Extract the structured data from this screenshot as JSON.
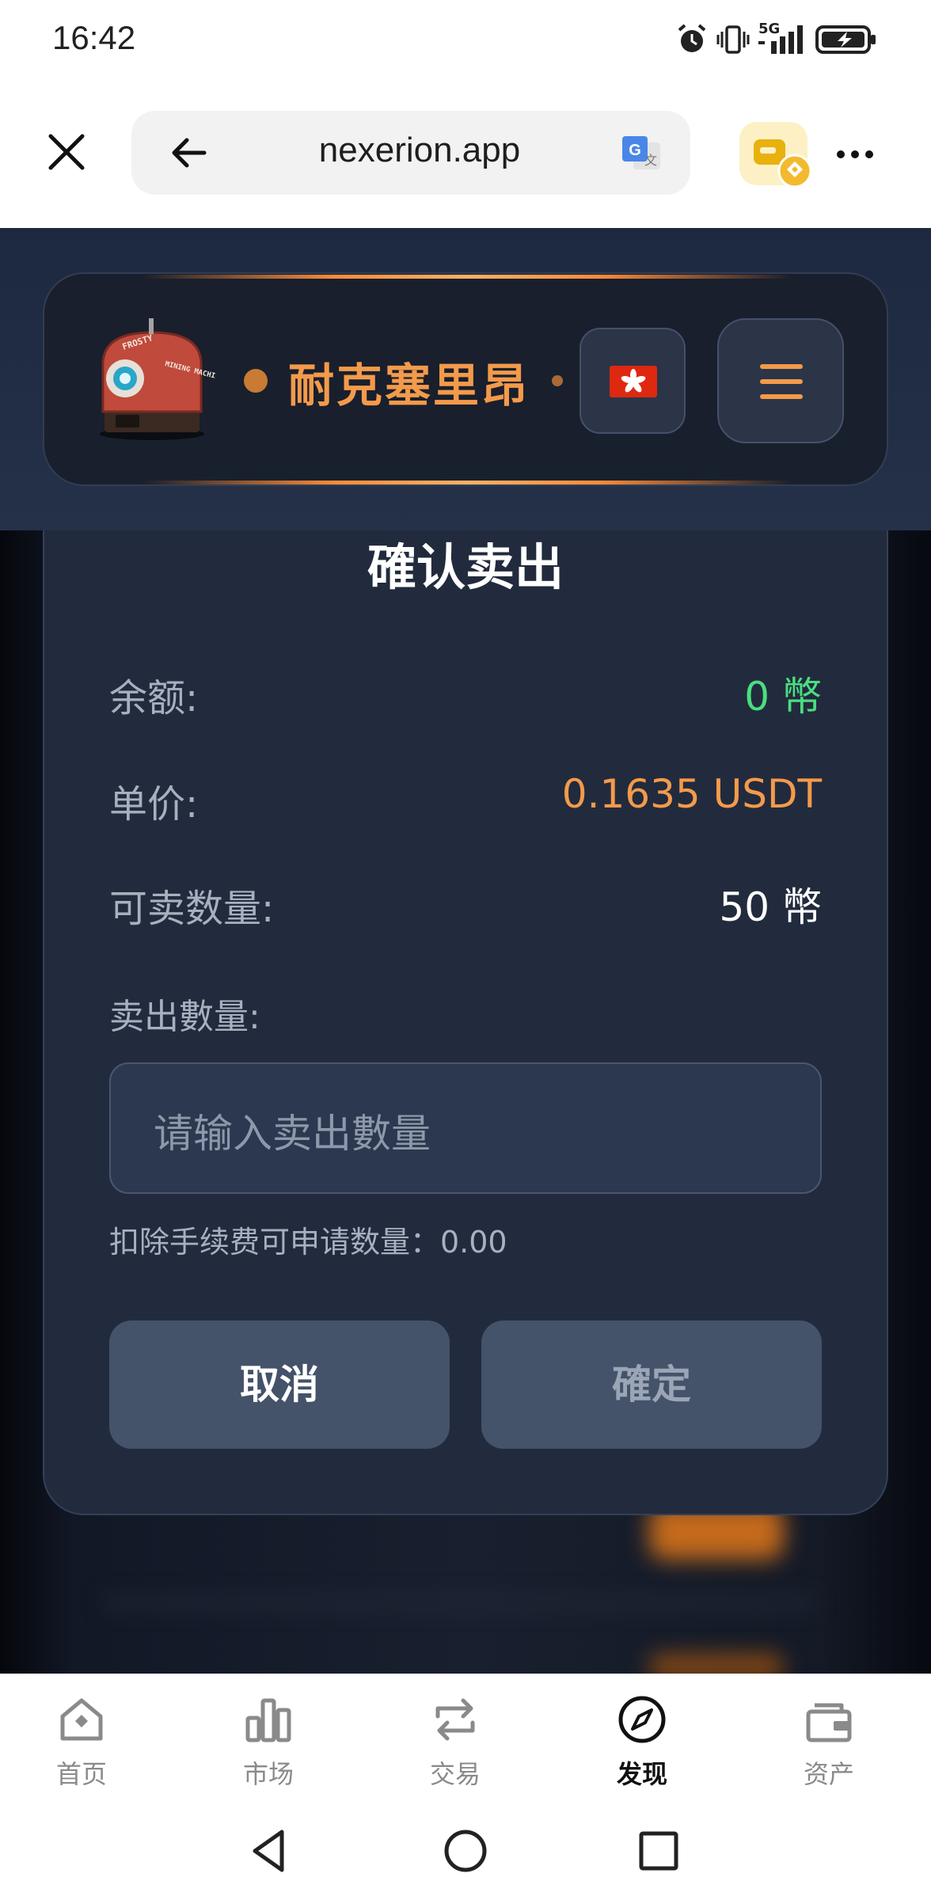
{
  "status_bar": {
    "time": "16:42",
    "network": "5G"
  },
  "browser": {
    "url": "nexerion.app"
  },
  "app": {
    "brand": "耐克塞里昂",
    "logo_text_1": "FROSTY",
    "logo_text_2": "MINING MACHINE"
  },
  "dialog": {
    "title": "確认卖出",
    "rows": [
      {
        "label": "余额:",
        "value": "0 幣",
        "color": "#4ade80"
      },
      {
        "label": "单价:",
        "value": "0.1635 USDT",
        "color": "#f59a4b"
      },
      {
        "label": "可卖数量:",
        "value": "50 幣",
        "color": "#ffffff"
      }
    ],
    "input_label": "卖出數量:",
    "input_placeholder": "请输入卖出數量",
    "fee_note": "扣除手续费可申请数量：0.00",
    "cancel_label": "取消",
    "confirm_label": "確定"
  },
  "bottom_nav": {
    "items": [
      {
        "label": "首页",
        "icon": "home-icon"
      },
      {
        "label": "市场",
        "icon": "market-icon"
      },
      {
        "label": "交易",
        "icon": "trade-icon"
      },
      {
        "label": "发现",
        "icon": "compass-icon",
        "active": true
      },
      {
        "label": "资产",
        "icon": "wallet-icon"
      }
    ]
  },
  "colors": {
    "accent": "#f39a4b",
    "balance_green": "#4ade80",
    "dialog_bg": "#222b3d",
    "header_bg": "#1d2940"
  }
}
